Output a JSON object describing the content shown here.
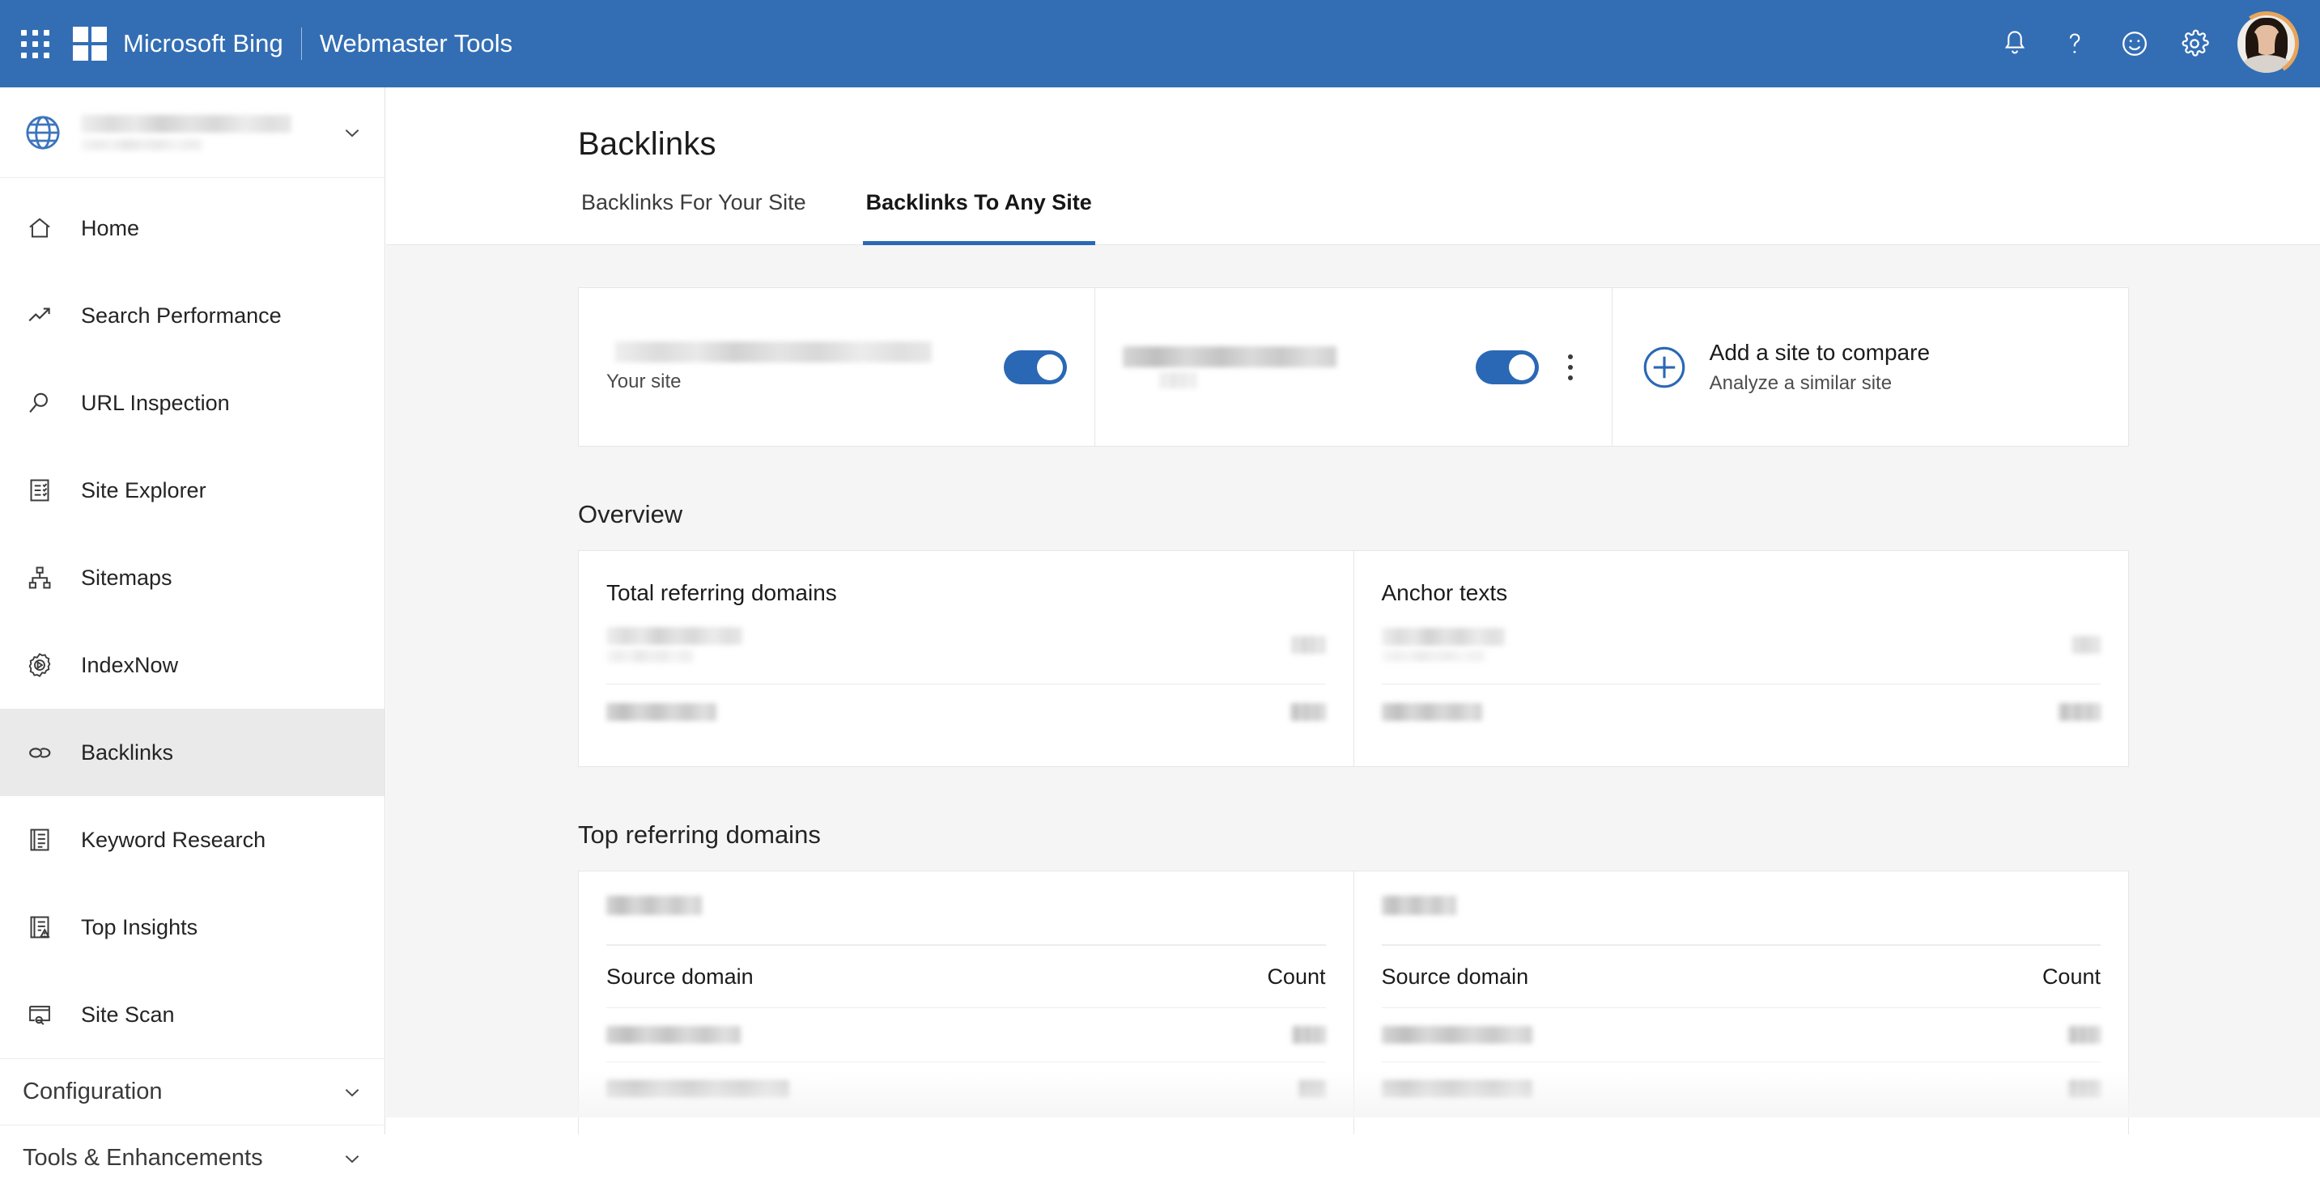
{
  "topbar": {
    "waffle_label": "app-launcher",
    "brand": "Microsoft Bing",
    "product": "Webmaster Tools",
    "icons": [
      "bell-icon",
      "question-icon",
      "smiley-icon",
      "gear-icon"
    ],
    "bg_color": "#336eb4"
  },
  "sidebar": {
    "site_selector": {
      "icon": "globe-icon",
      "site_name": "",
      "chevron": "chevron-down-icon"
    },
    "items": [
      {
        "label": "Home",
        "icon": "home-icon",
        "active": false
      },
      {
        "label": "Search Performance",
        "icon": "trending-up-icon",
        "active": false
      },
      {
        "label": "URL Inspection",
        "icon": "magnifier-icon",
        "active": false
      },
      {
        "label": "Site Explorer",
        "icon": "checklist-icon",
        "active": false
      },
      {
        "label": "Sitemaps",
        "icon": "sitemap-icon",
        "active": false
      },
      {
        "label": "IndexNow",
        "icon": "gear-indexnow-icon",
        "active": false
      },
      {
        "label": "Backlinks",
        "icon": "links-chain-icon",
        "active": true
      },
      {
        "label": "Keyword Research",
        "icon": "document-list-icon",
        "active": false
      },
      {
        "label": "Top Insights",
        "icon": "document-alert-icon",
        "active": false
      },
      {
        "label": "Site Scan",
        "icon": "window-search-icon",
        "active": false
      }
    ],
    "groups": [
      {
        "label": "Configuration",
        "chevron": "chevron-down-icon"
      },
      {
        "label": "Tools & Enhancements",
        "chevron": "chevron-down-icon"
      }
    ],
    "active_bg": "#eaeaea"
  },
  "main": {
    "title": "Backlinks",
    "tabs": [
      {
        "label": "Backlinks For Your Site",
        "active": false
      },
      {
        "label": "Backlinks To Any Site",
        "active": true
      }
    ],
    "tab_accent": "#2a68b5",
    "compare": {
      "cards": [
        {
          "site_name": "",
          "sublabel": "Your site",
          "toggle_on": true,
          "has_kebab": false
        },
        {
          "site_name": "",
          "sublabel": "",
          "toggle_on": true,
          "has_kebab": true
        }
      ],
      "add": {
        "icon": "plus-circle-icon",
        "title": "Add a site to compare",
        "subtitle": "Analyze a similar site"
      },
      "toggle_color": "#2a68b5"
    },
    "overview": {
      "heading": "Overview",
      "cards": [
        {
          "title": "Total referring domains",
          "rows": [
            {
              "label": "",
              "value": ""
            },
            {
              "label": "",
              "value": ""
            }
          ]
        },
        {
          "title": "Anchor texts",
          "rows": [
            {
              "label": "",
              "value": ""
            },
            {
              "label": "",
              "value": ""
            }
          ]
        }
      ]
    },
    "top_referring": {
      "heading": "Top referring domains",
      "tables": [
        {
          "site_label": "",
          "columns": {
            "domain": "Source domain",
            "count": "Count"
          },
          "rows": [
            {
              "domain": "",
              "count": ""
            },
            {
              "domain": "",
              "count": ""
            }
          ]
        },
        {
          "site_label": "",
          "columns": {
            "domain": "Source domain",
            "count": "Count"
          },
          "rows": [
            {
              "domain": "",
              "count": ""
            },
            {
              "domain": "",
              "count": ""
            }
          ]
        }
      ]
    }
  }
}
